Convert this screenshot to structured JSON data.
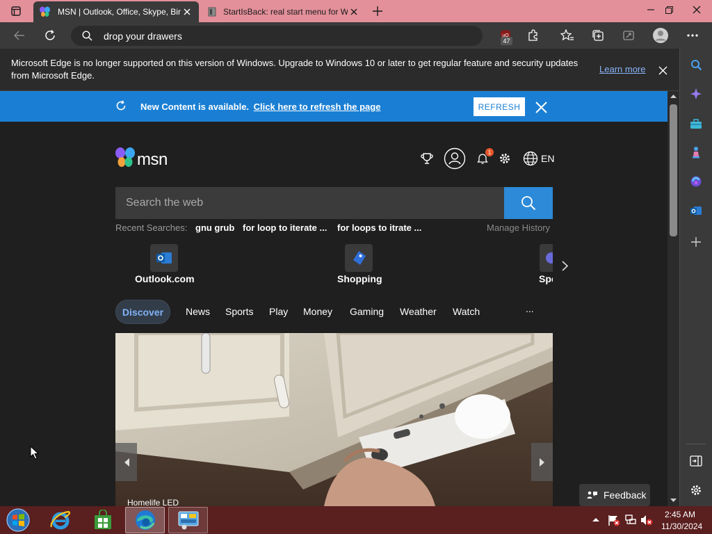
{
  "tabs": [
    {
      "title": "MSN | Outlook, Office, Skype, Bing"
    },
    {
      "title": "StartIsBack: real start menu for Windows"
    }
  ],
  "addressbar": {
    "query": "drop your drawers"
  },
  "toolbar": {
    "extension_badge": "47"
  },
  "banner": {
    "message": "Microsoft Edge is no longer supported on this version of Windows. Upgrade to Windows 10 or later to get regular feature and security updates from Microsoft Edge.",
    "link": "Learn more"
  },
  "refresh_bar": {
    "message": "New Content is available.",
    "link": "Click here to refresh the page",
    "button": "REFRESH"
  },
  "msn": {
    "brand": "msn",
    "language": "EN",
    "notification_count": "1",
    "search_placeholder": "Search the web",
    "recent_label": "Recent Searches:",
    "recent": [
      "gnu grub",
      "for loop to iterate ...",
      "for loops to itrate ..."
    ],
    "manage_history": "Manage History",
    "quick_links": [
      {
        "label": "Outlook.com",
        "icon": "outlook-icon"
      },
      {
        "label": "Shopping",
        "icon": "shopping-tag-icon"
      },
      {
        "label": "Spo",
        "icon": "sports-icon"
      }
    ],
    "nav": [
      "Discover",
      "News",
      "Sports",
      "Play",
      "Money",
      "Gaming",
      "Weather",
      "Watch"
    ],
    "nav_more": "...",
    "hero_caption": "Homelife LED",
    "feedback": "Feedback"
  },
  "taskbar": {
    "time": "2:45 AM",
    "date": "11/30/2024"
  },
  "colors": {
    "tabbar": "#e3909a",
    "toolbar": "#3a3a3a",
    "refresh_bar": "#1a7fd4",
    "search_button": "#2c8ad8",
    "taskbar": "#5a1f1f"
  }
}
